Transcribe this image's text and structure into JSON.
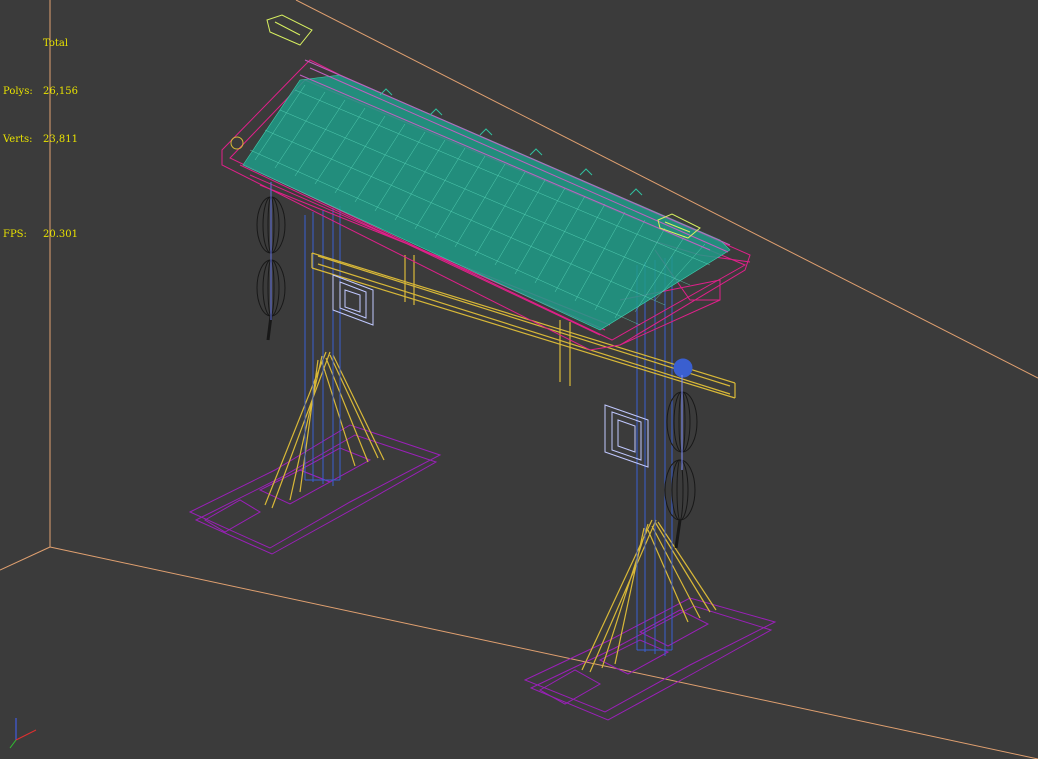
{
  "viewport": {
    "stats": {
      "title": "Total",
      "polys_label": "Polys:",
      "polys_value": "26,156",
      "verts_label": "Verts:",
      "verts_value": "23,811",
      "fps_label": "FPS:",
      "fps_value": "20.301"
    },
    "colors": {
      "background": "#3b3b3b",
      "grid_lines": "#e0a070",
      "stats_text": "#e8e200",
      "roof_tiles": "#1f9c88",
      "roof_frame": "#e0208a",
      "ridge": "#c060c0",
      "posts": "#3a5fd0",
      "braces": "#d8b838",
      "bases": "#9a20b8",
      "lanterns": "#202020",
      "brackets": "#c0c8ff",
      "finials": "#d8f060"
    },
    "gizmo": {
      "icon": "axis-gizmo-icon"
    }
  }
}
